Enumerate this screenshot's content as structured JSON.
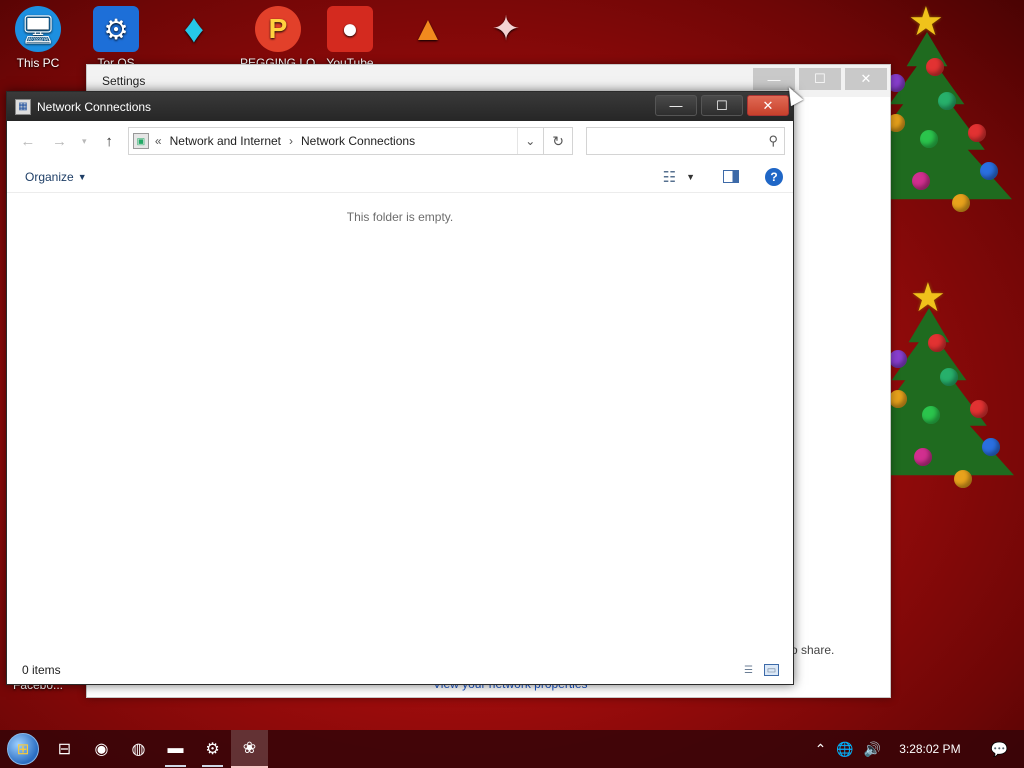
{
  "desktop": {
    "icons": [
      {
        "name": "this-pc-icon",
        "label": "This PC",
        "symbol": "🖥",
        "bg": "#1d8fe0"
      },
      {
        "name": "settings-app-icon",
        "label": "Tor OS",
        "symbol": "⚙",
        "bg": "#1d6fd8"
      },
      {
        "name": "gem-app-icon",
        "label": "",
        "symbol": "♦",
        "bg": "transparent"
      },
      {
        "name": "pegging-app-icon",
        "label": "PEGGING LOL",
        "symbol": "P",
        "bg": "#e2402a"
      },
      {
        "name": "angry-birds-icon",
        "label": "YouTube",
        "symbol": "●",
        "bg": "#d42a1f"
      },
      {
        "name": "vlc-icon",
        "label": "",
        "symbol": "▲",
        "bg": "transparent"
      },
      {
        "name": "gift-app-icon",
        "label": "",
        "symbol": "✦",
        "bg": "transparent"
      }
    ],
    "bottom_left_label": "Facebo..."
  },
  "settings_window": {
    "title": "Settings",
    "minimize": "—",
    "maximize": "☐",
    "close": "✕",
    "share_text": "o share.",
    "link_text": "View your network properties"
  },
  "explorer": {
    "title": "Network Connections",
    "minimize": "—",
    "maximize": "☐",
    "close": "✕",
    "breadcrumb_prefix": "«",
    "breadcrumb": [
      "Network and Internet",
      "Network Connections"
    ],
    "search_placeholder": "",
    "organize_label": "Organize",
    "empty_message": "This folder is empty.",
    "status_text": "0 items"
  },
  "taskbar": {
    "items": [
      {
        "name": "task-view-button",
        "symbol": "⊟",
        "state": ""
      },
      {
        "name": "chrome-taskbar-button",
        "symbol": "◉",
        "state": ""
      },
      {
        "name": "firefox-taskbar-button",
        "symbol": "◍",
        "state": ""
      },
      {
        "name": "file-explorer-taskbar-button",
        "symbol": "▬",
        "state": "running"
      },
      {
        "name": "settings-taskbar-button",
        "symbol": "⚙",
        "state": "running"
      },
      {
        "name": "network-connections-taskbar-button",
        "symbol": "❀",
        "state": "active"
      }
    ],
    "clock": "3:28:02 PM"
  },
  "colors": {
    "desktop_bg": "#b01414",
    "titlebar": "#2b2b2b",
    "close_button": "#d9533f",
    "accent_link": "#1a55c8",
    "taskbar": "#3a0508"
  }
}
